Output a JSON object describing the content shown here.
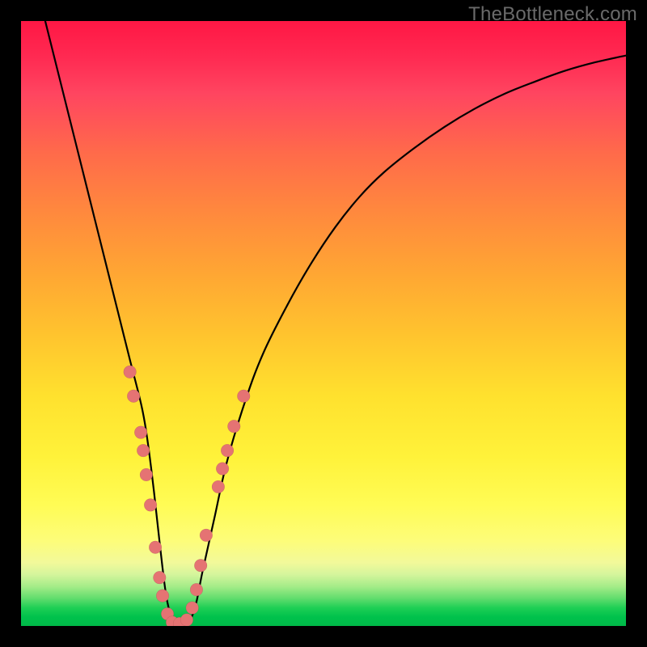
{
  "watermark": "TheBottleneck.com",
  "colors": {
    "dot": "#e57373",
    "curve": "#000000",
    "gradient_stops": [
      "#ff1744",
      "#ff4560",
      "#ff8a3d",
      "#ffc42e",
      "#fff23a",
      "#fdfd7a",
      "#a4ec88",
      "#00c24c"
    ]
  },
  "chart_data": {
    "type": "line",
    "title": "",
    "xlabel": "",
    "ylabel": "",
    "xlim": [
      0,
      100
    ],
    "ylim": [
      0,
      100
    ],
    "series": [
      {
        "name": "bottleneck-curve",
        "x": [
          4,
          6,
          8,
          10,
          12,
          14,
          16,
          18,
          20,
          21,
          22,
          23,
          24,
          25,
          26,
          27,
          28,
          29,
          30,
          32,
          34,
          37,
          40,
          44,
          48,
          52,
          56,
          60,
          65,
          70,
          75,
          80,
          85,
          90,
          95,
          100
        ],
        "values": [
          100,
          92,
          84,
          76,
          68,
          60,
          52,
          44,
          36,
          30,
          22,
          13,
          5,
          1,
          0,
          0,
          1,
          4,
          9,
          18,
          27,
          37,
          45,
          53,
          60,
          66,
          71,
          75,
          79,
          82.5,
          85.5,
          88,
          90,
          91.8,
          93.2,
          94.3
        ]
      }
    ],
    "markers": [
      {
        "x": 18.0,
        "y": 42
      },
      {
        "x": 18.6,
        "y": 38
      },
      {
        "x": 19.8,
        "y": 32
      },
      {
        "x": 20.2,
        "y": 29
      },
      {
        "x": 20.7,
        "y": 25
      },
      {
        "x": 21.4,
        "y": 20
      },
      {
        "x": 22.2,
        "y": 13
      },
      {
        "x": 22.9,
        "y": 8
      },
      {
        "x": 23.4,
        "y": 5
      },
      {
        "x": 24.2,
        "y": 2
      },
      {
        "x": 25.0,
        "y": 0.6
      },
      {
        "x": 26.2,
        "y": 0.4
      },
      {
        "x": 27.4,
        "y": 1.0
      },
      {
        "x": 28.3,
        "y": 3
      },
      {
        "x": 29.0,
        "y": 6
      },
      {
        "x": 29.7,
        "y": 10
      },
      {
        "x": 30.6,
        "y": 15
      },
      {
        "x": 32.6,
        "y": 23
      },
      {
        "x": 33.3,
        "y": 26
      },
      {
        "x": 34.1,
        "y": 29
      },
      {
        "x": 35.2,
        "y": 33
      },
      {
        "x": 36.8,
        "y": 38
      }
    ],
    "marker_radius": 1.05
  }
}
